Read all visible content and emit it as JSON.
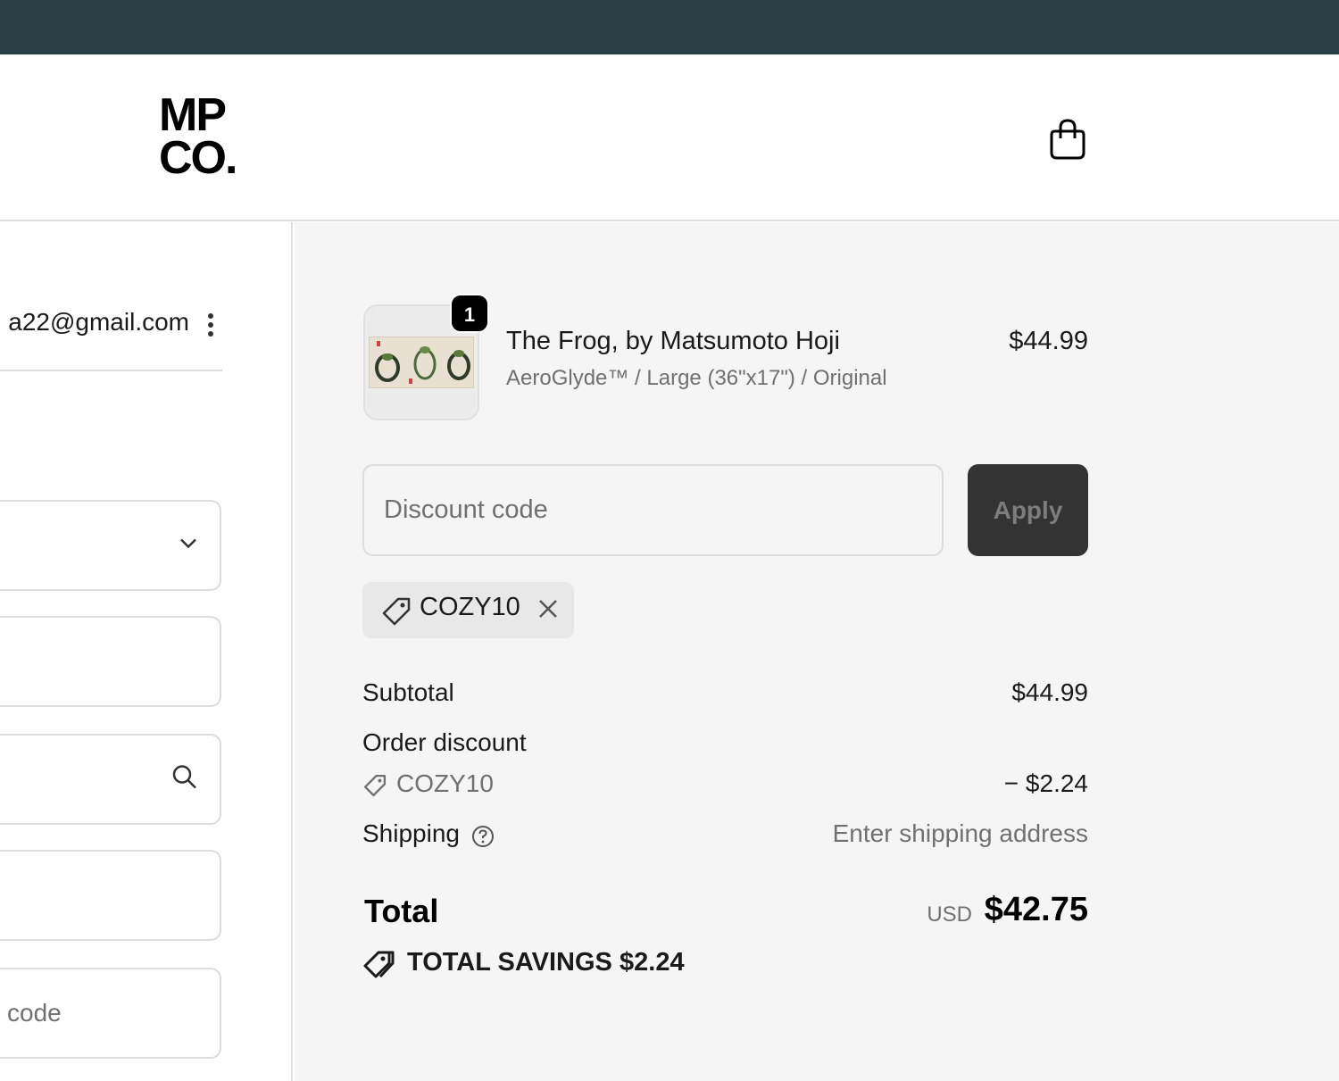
{
  "header": {
    "logo_line1": "MP",
    "logo_line2": "CO."
  },
  "left": {
    "email": "a22@gmail.com",
    "last_field_placeholder": "code"
  },
  "order": {
    "quantity": "1",
    "product_title": "The Frog, by Matsumoto Hoji",
    "product_variant": "AeroGlyde™ / Large (36\"x17\") / Original",
    "product_price": "$44.99"
  },
  "discount": {
    "placeholder": "Discount code",
    "apply_label": "Apply",
    "applied_code": "COZY10"
  },
  "summary": {
    "subtotal_label": "Subtotal",
    "subtotal_value": "$44.99",
    "order_discount_label": "Order discount",
    "discount_code": "COZY10",
    "discount_value": "− $2.24",
    "shipping_label": "Shipping",
    "shipping_value": "Enter shipping address",
    "total_label": "Total",
    "currency": "USD",
    "total_value": "$42.75",
    "savings_label": "TOTAL SAVINGS",
    "savings_value": "$2.24"
  },
  "colors": {
    "topbar": "#2a3d42",
    "summary_bg": "#f5f5f5",
    "apply_bg": "#333333"
  }
}
